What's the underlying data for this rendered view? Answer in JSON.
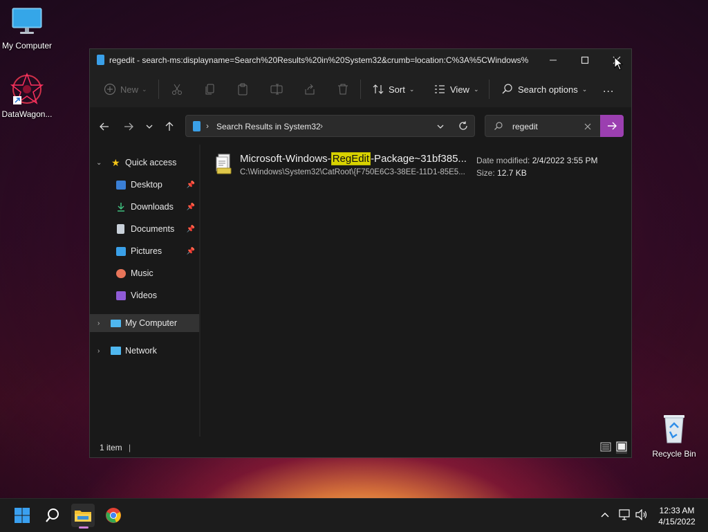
{
  "desktop": {
    "icons": [
      {
        "label": "My Computer",
        "icon": "monitor-icon"
      },
      {
        "label": "DataWagon...",
        "icon": "app-shortcut-icon"
      },
      {
        "label": "Recycle Bin",
        "icon": "recycle-bin-icon"
      }
    ]
  },
  "window": {
    "title": "regedit - search-ms:displayname=Search%20Results%20in%20System32&crumb=location:C%3A%5CWindows%",
    "controls": [
      "minimize",
      "maximize",
      "close"
    ]
  },
  "toolbar": {
    "new_label": "New",
    "sort_label": "Sort",
    "view_label": "View",
    "search_options_label": "Search options",
    "more_label": "..."
  },
  "address": {
    "breadcrumb": "Search Results in System32",
    "search_value": "regedit"
  },
  "nav": {
    "quick_access": "Quick access",
    "items": [
      {
        "label": "Desktop",
        "pinned": true,
        "color": "#3a7fd5"
      },
      {
        "label": "Downloads",
        "pinned": true,
        "color": "#3fbf7f"
      },
      {
        "label": "Documents",
        "pinned": true,
        "color": "#c9d1da"
      },
      {
        "label": "Pictures",
        "pinned": true,
        "color": "#3aa0e8"
      },
      {
        "label": "Music",
        "pinned": false,
        "color": "#e8755a"
      },
      {
        "label": "Videos",
        "pinned": false,
        "color": "#8f5bd6"
      }
    ],
    "my_computer": "My Computer",
    "network": "Network"
  },
  "results": {
    "items": [
      {
        "name_before": "Microsoft-Windows-",
        "name_highlight": "RegEdit",
        "name_after": "-Package~31bf385...",
        "path": "C:\\Windows\\System32\\CatRoot\\{F750E6C3-38EE-11D1-85E5...",
        "date_label": "Date modified:",
        "date_value": "2/4/2022 3:55 PM",
        "size_label": "Size:",
        "size_value": "12.7 KB"
      }
    ]
  },
  "status": {
    "item_count": "1 item"
  },
  "taskbar": {
    "time": "12:33 AM",
    "date": "4/15/2022"
  },
  "colors": {
    "accent": "#9b3fb0",
    "highlight": "#d8d200"
  }
}
